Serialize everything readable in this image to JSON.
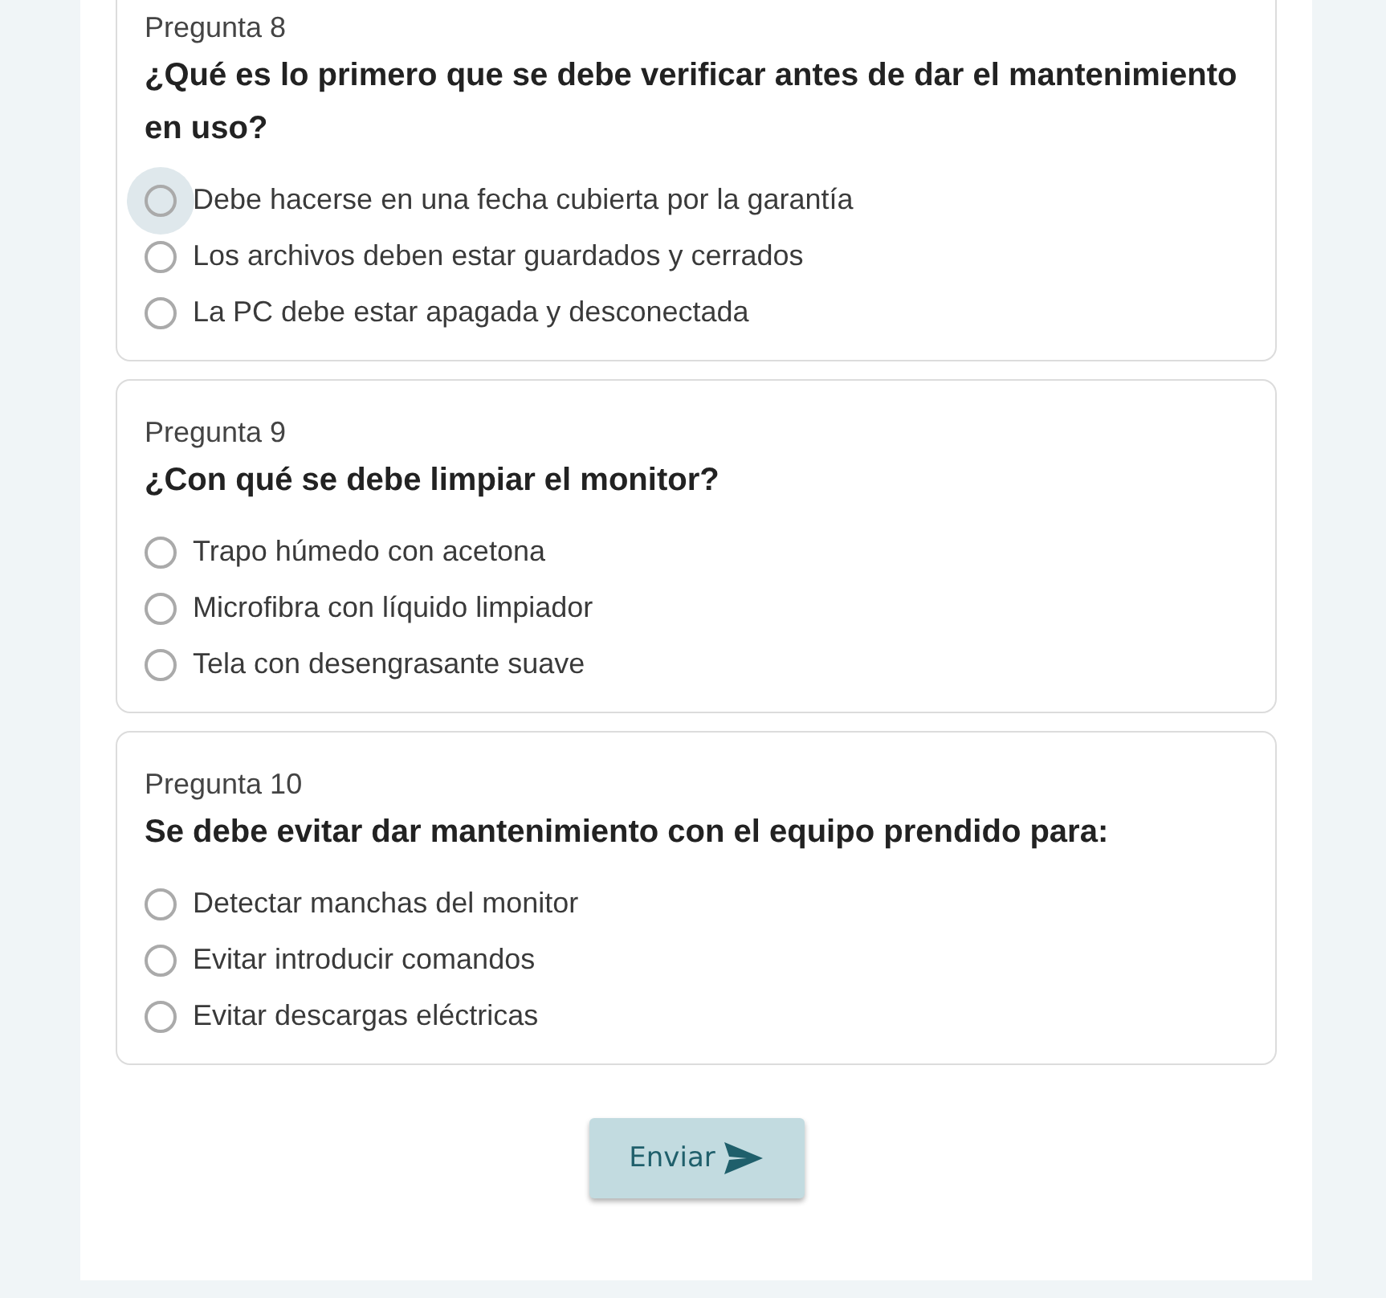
{
  "questions": [
    {
      "number": "Pregunta 8",
      "text": "¿Qué es lo primero que se debe verificar antes de dar el mantenimiento en uso?",
      "options": [
        {
          "label": "Debe hacerse en una fecha cubierta por la garantía",
          "selected": false,
          "focused": true
        },
        {
          "label": "Los archivos deben estar guardados y cerrados",
          "selected": false,
          "focused": false
        },
        {
          "label": "La PC debe estar apagada y desconectada",
          "selected": false,
          "focused": false
        }
      ]
    },
    {
      "number": "Pregunta 9",
      "text": "¿Con qué se debe limpiar el monitor?",
      "options": [
        {
          "label": "Trapo húmedo con acetona",
          "selected": false,
          "focused": false
        },
        {
          "label": "Microfibra con líquido limpiador",
          "selected": false,
          "focused": false
        },
        {
          "label": "Tela con desengrasante suave",
          "selected": false,
          "focused": false
        }
      ]
    },
    {
      "number": "Pregunta 10",
      "text": "Se debe evitar dar mantenimiento con el equipo prendido para:",
      "options": [
        {
          "label": "Detectar manchas del monitor",
          "selected": false,
          "focused": false
        },
        {
          "label": "Evitar introducir comandos",
          "selected": false,
          "focused": false
        },
        {
          "label": "Evitar descargas eléctricas",
          "selected": false,
          "focused": false
        }
      ]
    }
  ],
  "submit": {
    "label": "Enviar"
  }
}
